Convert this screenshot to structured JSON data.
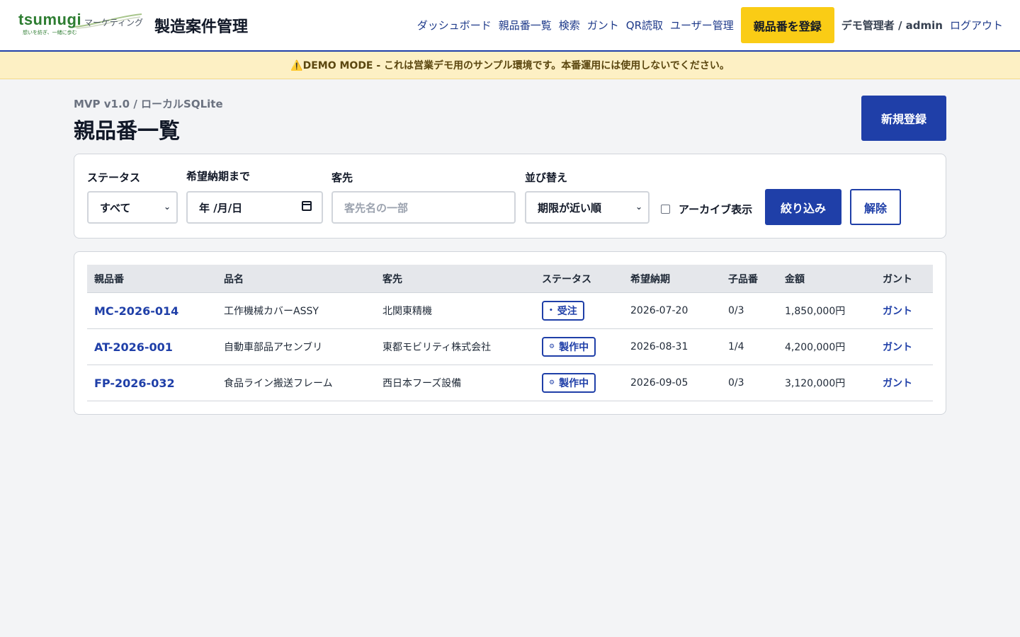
{
  "brand": {
    "logo_main": "tsumugi",
    "logo_sub": "マーケティング",
    "logo_tagline": "想いを紡ぎ、一緒に歩む",
    "app_title": "製造案件管理"
  },
  "nav": {
    "items": [
      "ダッシュボード",
      "親品番一覧",
      "検索",
      "ガント",
      "QR読取",
      "ユーザー管理"
    ],
    "register_label": "親品番を登録",
    "user_label": "デモ管理者 / admin",
    "logout_label": "ログアウト"
  },
  "demo_banner": "⚠️DEMO MODE - これは営業デモ用のサンプル環境です。本番運用には使用しないでください。",
  "page": {
    "subtitle": "MVP v1.0 / ローカルSQLite",
    "title": "親品番一覧",
    "new_button": "新規登録"
  },
  "filters": {
    "status_label": "ステータス",
    "status_value": "すべて",
    "due_label": "希望納期まで",
    "due_value": "年 /月/日",
    "customer_label": "客先",
    "customer_placeholder": "客先名の一部",
    "sort_label": "並び替え",
    "sort_value": "期限が近い順",
    "archive_label": "アーカイブ表示",
    "archive_checked": false,
    "apply_button": "絞り込み",
    "clear_button": "解除"
  },
  "table": {
    "headers": [
      "親品番",
      "品名",
      "客先",
      "ステータス",
      "希望納期",
      "子品番",
      "金額",
      "ガント"
    ],
    "rows": [
      {
        "code": "MC-2026-014",
        "name": "工作機械カバーASSY",
        "customer": "北関東精機",
        "status_icon": "•",
        "status": "受注",
        "due": "2026-07-20",
        "children": "0/3",
        "amount": "1,850,000円",
        "gantt": "ガント"
      },
      {
        "code": "AT-2026-001",
        "name": "自動車部品アセンブリ",
        "customer": "東都モビリティ株式会社",
        "status_icon": "⚙",
        "status": "製作中",
        "due": "2026-08-31",
        "children": "1/4",
        "amount": "4,200,000円",
        "gantt": "ガント"
      },
      {
        "code": "FP-2026-032",
        "name": "食品ライン搬送フレーム",
        "customer": "西日本フーズ設備",
        "status_icon": "⚙",
        "status": "製作中",
        "due": "2026-09-05",
        "children": "0/3",
        "amount": "3,120,000円",
        "gantt": "ガント"
      }
    ]
  },
  "colors": {
    "primary": "#1f3fa8",
    "accent_yellow": "#facc15",
    "banner_bg": "#fdf0c4",
    "brand_green": "#2e7d32"
  }
}
